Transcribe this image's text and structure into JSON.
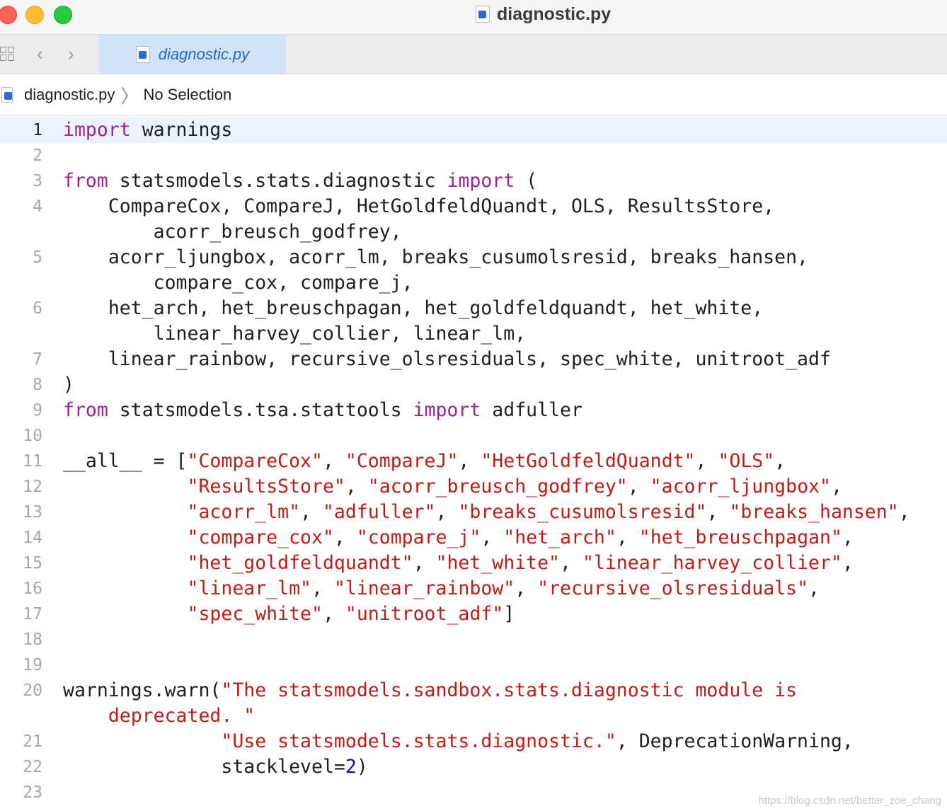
{
  "window": {
    "title": "diagnostic.py"
  },
  "tabbar": {
    "tab_label": "diagnostic.py"
  },
  "breadcrumb": {
    "file": "diagnostic.py",
    "selection": "No Selection"
  },
  "editor": {
    "lines": [
      {
        "n": "1",
        "segs": [
          [
            "kw",
            "import"
          ],
          [
            "t",
            " warnings"
          ]
        ]
      },
      {
        "n": "2",
        "segs": []
      },
      {
        "n": "3",
        "segs": [
          [
            "kw",
            "from"
          ],
          [
            "t",
            " statsmodels.stats.diagnostic "
          ],
          [
            "kw",
            "import"
          ],
          [
            "t",
            " ("
          ]
        ]
      },
      {
        "n": "4",
        "segs": [
          [
            "t",
            "    CompareCox, CompareJ, HetGoldfeldQuandt, OLS, ResultsStore,"
          ]
        ]
      },
      {
        "n": "",
        "segs": [
          [
            "t",
            "        acorr_breusch_godfrey,"
          ]
        ]
      },
      {
        "n": "5",
        "segs": [
          [
            "t",
            "    acorr_ljungbox, acorr_lm, breaks_cusumolsresid, breaks_hansen,"
          ]
        ]
      },
      {
        "n": "",
        "segs": [
          [
            "t",
            "        compare_cox, compare_j,"
          ]
        ]
      },
      {
        "n": "6",
        "segs": [
          [
            "t",
            "    het_arch, het_breuschpagan, het_goldfeldquandt, het_white,"
          ]
        ]
      },
      {
        "n": "",
        "segs": [
          [
            "t",
            "        linear_harvey_collier, linear_lm,"
          ]
        ]
      },
      {
        "n": "7",
        "segs": [
          [
            "t",
            "    linear_rainbow, recursive_olsresiduals, spec_white, unitroot_adf"
          ]
        ]
      },
      {
        "n": "8",
        "segs": [
          [
            "t",
            ")"
          ]
        ]
      },
      {
        "n": "9",
        "segs": [
          [
            "kw",
            "from"
          ],
          [
            "t",
            " statsmodels.tsa.stattools "
          ],
          [
            "kw",
            "import"
          ],
          [
            "t",
            " adfuller"
          ]
        ]
      },
      {
        "n": "10",
        "segs": []
      },
      {
        "n": "11",
        "segs": [
          [
            "t",
            "__all__ = ["
          ],
          [
            "str",
            "\"CompareCox\""
          ],
          [
            "t",
            ", "
          ],
          [
            "str",
            "\"CompareJ\""
          ],
          [
            "t",
            ", "
          ],
          [
            "str",
            "\"HetGoldfeldQuandt\""
          ],
          [
            "t",
            ", "
          ],
          [
            "str",
            "\"OLS\""
          ],
          [
            "t",
            ","
          ]
        ]
      },
      {
        "n": "12",
        "segs": [
          [
            "t",
            "           "
          ],
          [
            "str",
            "\"ResultsStore\""
          ],
          [
            "t",
            ", "
          ],
          [
            "str",
            "\"acorr_breusch_godfrey\""
          ],
          [
            "t",
            ", "
          ],
          [
            "str",
            "\"acorr_ljungbox\""
          ],
          [
            "t",
            ","
          ]
        ]
      },
      {
        "n": "13",
        "segs": [
          [
            "t",
            "           "
          ],
          [
            "str",
            "\"acorr_lm\""
          ],
          [
            "t",
            ", "
          ],
          [
            "str",
            "\"adfuller\""
          ],
          [
            "t",
            ", "
          ],
          [
            "str",
            "\"breaks_cusumolsresid\""
          ],
          [
            "t",
            ", "
          ],
          [
            "str",
            "\"breaks_hansen\""
          ],
          [
            "t",
            ","
          ]
        ]
      },
      {
        "n": "14",
        "segs": [
          [
            "t",
            "           "
          ],
          [
            "str",
            "\"compare_cox\""
          ],
          [
            "t",
            ", "
          ],
          [
            "str",
            "\"compare_j\""
          ],
          [
            "t",
            ", "
          ],
          [
            "str",
            "\"het_arch\""
          ],
          [
            "t",
            ", "
          ],
          [
            "str",
            "\"het_breuschpagan\""
          ],
          [
            "t",
            ","
          ]
        ]
      },
      {
        "n": "15",
        "segs": [
          [
            "t",
            "           "
          ],
          [
            "str",
            "\"het_goldfeldquandt\""
          ],
          [
            "t",
            ", "
          ],
          [
            "str",
            "\"het_white\""
          ],
          [
            "t",
            ", "
          ],
          [
            "str",
            "\"linear_harvey_collier\""
          ],
          [
            "t",
            ","
          ]
        ]
      },
      {
        "n": "16",
        "segs": [
          [
            "t",
            "           "
          ],
          [
            "str",
            "\"linear_lm\""
          ],
          [
            "t",
            ", "
          ],
          [
            "str",
            "\"linear_rainbow\""
          ],
          [
            "t",
            ", "
          ],
          [
            "str",
            "\"recursive_olsresiduals\""
          ],
          [
            "t",
            ","
          ]
        ]
      },
      {
        "n": "17",
        "segs": [
          [
            "t",
            "           "
          ],
          [
            "str",
            "\"spec_white\""
          ],
          [
            "t",
            ", "
          ],
          [
            "str",
            "\"unitroot_adf\""
          ],
          [
            "t",
            "]"
          ]
        ]
      },
      {
        "n": "18",
        "segs": []
      },
      {
        "n": "19",
        "segs": []
      },
      {
        "n": "20",
        "segs": [
          [
            "t",
            "warnings.warn("
          ],
          [
            "str",
            "\"The statsmodels.sandbox.stats.diagnostic module is"
          ]
        ]
      },
      {
        "n": "",
        "segs": [
          [
            "str",
            "    deprecated. \""
          ]
        ]
      },
      {
        "n": "21",
        "segs": [
          [
            "t",
            "              "
          ],
          [
            "str",
            "\"Use statsmodels.stats.diagnostic.\""
          ],
          [
            "t",
            ", DeprecationWarning,"
          ]
        ]
      },
      {
        "n": "22",
        "segs": [
          [
            "t",
            "              stacklevel="
          ],
          [
            "num",
            "2"
          ],
          [
            "t",
            ")"
          ]
        ]
      },
      {
        "n": "23",
        "segs": []
      }
    ]
  },
  "watermark": "https://blog.csdn.net/better_zoe_chang"
}
